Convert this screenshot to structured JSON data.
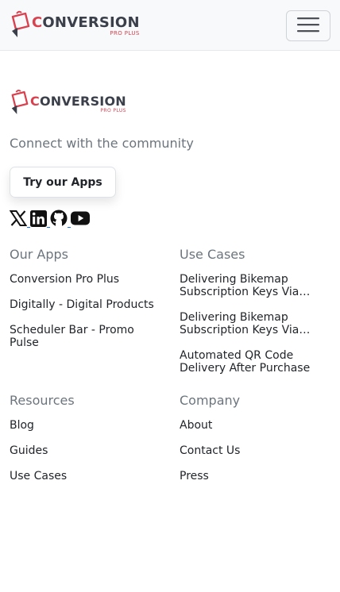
{
  "brand": {
    "word_first": "C",
    "word_rest": "ONVERSION",
    "sub": "PRO PLUS"
  },
  "tagline": "Connect with the community",
  "apps_button": "Try our Apps",
  "social": [
    "x-icon",
    "linkedin-icon",
    "github-icon",
    "youtube-icon"
  ],
  "sections": {
    "apps": {
      "heading": "Our Apps",
      "items": [
        "Conversion Pro Plus",
        "Digitally - Digital Products",
        "Scheduler Bar - Promo Pulse"
      ]
    },
    "use_cases": {
      "heading": "Use Cases",
      "items": [
        "Delivering Bikemap Subscription Keys Via Email",
        "Delivering Bikemap Subscription Keys Via Email",
        "Automated QR Code Delivery After Purchase"
      ]
    },
    "resources": {
      "heading": "Resources",
      "items": [
        "Blog",
        "Guides",
        "Use Cases"
      ]
    },
    "company": {
      "heading": "Company",
      "items": [
        "About",
        "Contact Us",
        "Press"
      ]
    }
  },
  "colors": {
    "brand_red": "#d9414f",
    "brand_dark": "#3a3f4a",
    "muted": "#6c757d",
    "link": "#0d6efd"
  }
}
